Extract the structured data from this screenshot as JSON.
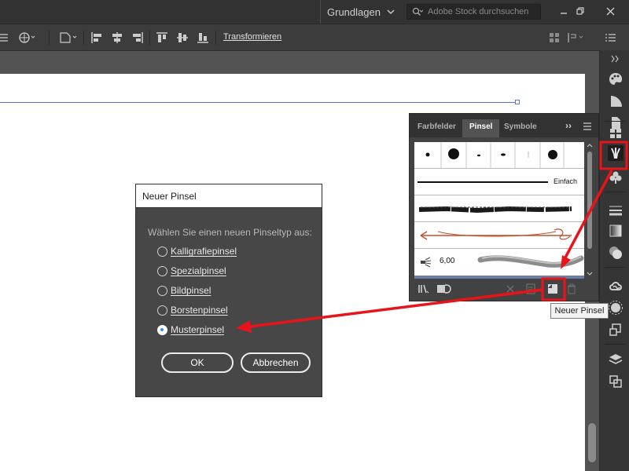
{
  "titlebar": {
    "workspace_label": "Grundlagen",
    "search_placeholder": "Adobe Stock durchsuchen"
  },
  "controlbar": {
    "transform_label": "Transformieren"
  },
  "brushes_panel": {
    "tabs": [
      {
        "label": "Farbfelder",
        "active": false
      },
      {
        "label": "Pinsel",
        "active": true
      },
      {
        "label": "Symbole",
        "active": false
      }
    ],
    "collapse_label": "››",
    "basic_brush_label": "Einfach",
    "bristle_size": "6,00"
  },
  "tooltip": {
    "text": "Neuer Pinsel"
  },
  "dialog": {
    "title": "Neuer Pinsel",
    "prompt": "Wählen Sie einen neuen Pinseltyp aus:",
    "options": [
      {
        "label": "Kalligrafiepinsel",
        "checked": false
      },
      {
        "label": "Spezialpinsel",
        "checked": false
      },
      {
        "label": "Bildpinsel",
        "checked": false
      },
      {
        "label": "Borstenpinsel",
        "checked": false
      },
      {
        "label": "Musterpinsel",
        "checked": true
      }
    ],
    "ok_label": "OK",
    "cancel_label": "Abbrechen"
  },
  "colors": {
    "highlight_red": "#e8141a",
    "radio_accent": "#3b8eea",
    "guide_blue": "#5b76d8"
  }
}
